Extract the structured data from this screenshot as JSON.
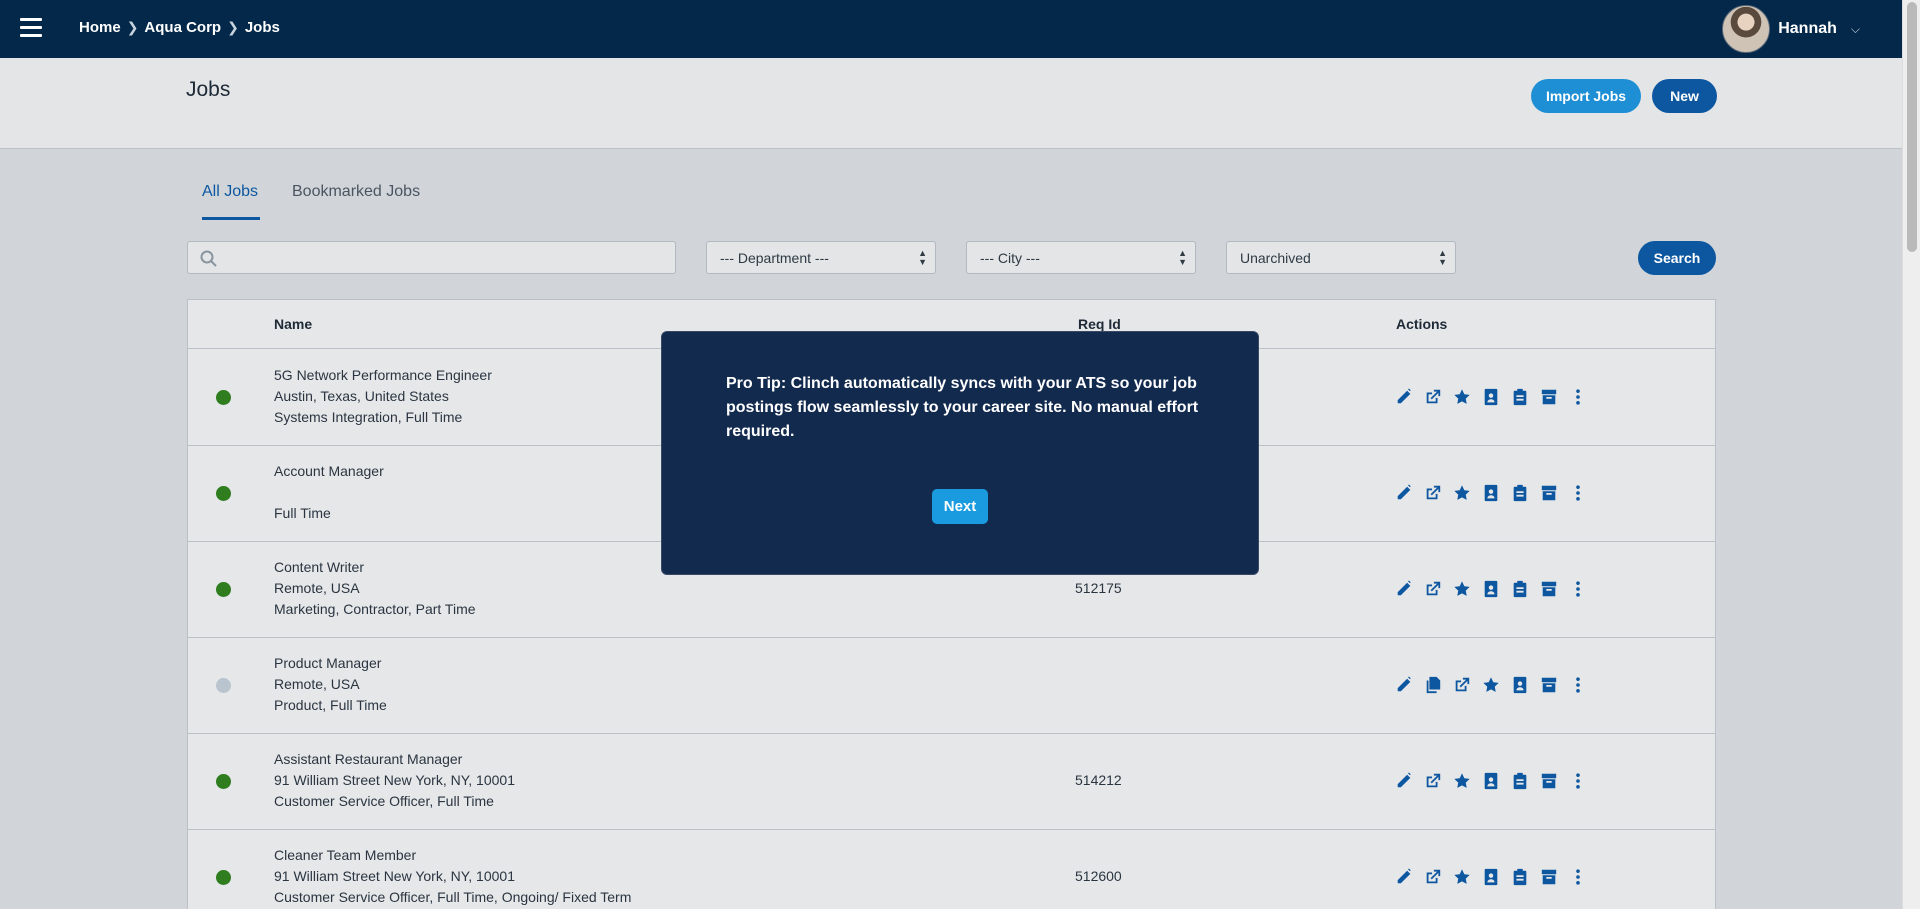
{
  "topbar": {
    "breadcrumb": [
      "Home",
      "Aqua Corp",
      "Jobs"
    ],
    "user_name": "Hannah"
  },
  "header": {
    "title": "Jobs",
    "import_label": "Import Jobs",
    "new_label": "New"
  },
  "tabs": [
    {
      "label": "All Jobs",
      "active": true
    },
    {
      "label": "Bookmarked Jobs",
      "active": false
    }
  ],
  "filters": {
    "search_value": "",
    "department": "--- Department ---",
    "city": "--- City ---",
    "status": "Unarchived",
    "search_label": "Search"
  },
  "table": {
    "columns": [
      "Name",
      "Req Id",
      "Actions"
    ],
    "rows": [
      {
        "status": "active",
        "title": "5G Network Performance Engineer",
        "location": "Austin, Texas, United States",
        "meta": "Systems Integration, Full Time",
        "req_id": ""
      },
      {
        "status": "active",
        "title": "Account Manager",
        "location": "",
        "meta": "Full Time",
        "req_id": ""
      },
      {
        "status": "active",
        "title": "Content Writer",
        "location": "Remote, USA",
        "meta": "Marketing, Contractor, Part Time",
        "req_id": "512175"
      },
      {
        "status": "inactive",
        "title": "Product Manager",
        "location": "Remote, USA",
        "meta": "Product, Full Time",
        "req_id": ""
      },
      {
        "status": "active",
        "title": "Assistant Restaurant Manager",
        "location": "91 William Street New York, NY, 10001",
        "meta": "Customer Service Officer, Full Time",
        "req_id": "514212"
      },
      {
        "status": "active",
        "title": "Cleaner Team Member",
        "location": "91 William Street New York, NY, 10001",
        "meta": "Customer Service Officer, Full Time, Ongoing/ Fixed Term",
        "req_id": "512600"
      }
    ]
  },
  "modal": {
    "text": "Pro Tip: Clinch automatically syncs with your ATS so your job postings flow seamlessly to your career site. No manual effort required.",
    "next_label": "Next"
  },
  "colors": {
    "navbar": "#03284a",
    "primary": "#0d57a0",
    "accent": "#1e8fd5",
    "modal_bg": "#132a4f",
    "active_dot": "#2f7d1f",
    "inactive_dot": "#b9c4cf"
  },
  "icons": {
    "actions_standard": [
      "pencil-icon",
      "external-link-icon",
      "star-icon",
      "contact-card-icon",
      "clipboard-icon",
      "archive-icon",
      "more-vertical-icon"
    ],
    "actions_inactive": [
      "pencil-icon",
      "copy-icon",
      "external-link-icon",
      "star-icon",
      "contact-card-icon",
      "archive-icon",
      "more-vertical-icon"
    ]
  }
}
